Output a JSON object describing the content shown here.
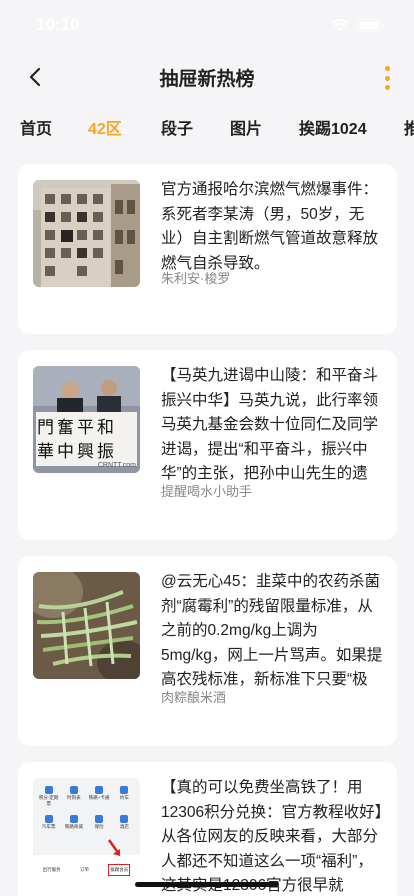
{
  "status": {
    "time": "10:10"
  },
  "nav": {
    "title": "抽屉新热榜"
  },
  "tabs": [
    {
      "label": "首页",
      "active": false
    },
    {
      "label": "42区",
      "active": true
    },
    {
      "label": "段子",
      "active": false
    },
    {
      "label": "图片",
      "active": false
    },
    {
      "label": "挨踢1024",
      "active": false
    },
    {
      "label": "推",
      "active": false
    }
  ],
  "colors": {
    "accent": "#f5a623",
    "background": "#f5f5f7",
    "card": "#ffffff"
  },
  "posts": [
    {
      "text": "官方通报哈尔滨燃气燃爆事件：系死者李某涛（男，50岁，无业）自主割断燃气管道故意释放燃气自杀导致。",
      "author": "朱利安·梭罗",
      "thumb_icon": "building-photo"
    },
    {
      "text": "【马英九进谒中山陵：和平奋斗 振兴中华】马英九说，此行率领马英九基金会数十位同仁及同学进谒，提出“和平奋斗，振兴中华”的主张，把孙中山先生的遗",
      "author": "提醒喝水小助手",
      "thumb_icon": "banner-photo",
      "thumb_caption_line1": "門奮平和",
      "thumb_caption_line2": "華中興振",
      "thumb_watermark": "CRNTT.com"
    },
    {
      "text": "@云无心45：韭菜中的农药杀菌剂“腐霉利”的残留限量标准，从之前的0.2mg/kg上调为5mg/kg，网上一片骂声。如果提高农残标准，新标准下只要“极端食用",
      "author": "肉粽酿米酒",
      "thumb_icon": "chive-photo"
    },
    {
      "text": "【真的可以免费坐高铁了！用12306积分兑换：官方教程收好】从各位网友的反映来看，大部分人都还不知道这么一项“福利”，这其实是12306官方很早就",
      "author": "",
      "thumb_icon": "app-screenshot",
      "thumb_labels": [
        "积分·定期票",
        "时刻表",
        "铁路+卡通",
        "约车",
        "汽车票",
        "铁路商城",
        "保险",
        "酒店",
        "出行服务",
        "订单",
        "挨踢会员"
      ]
    }
  ]
}
